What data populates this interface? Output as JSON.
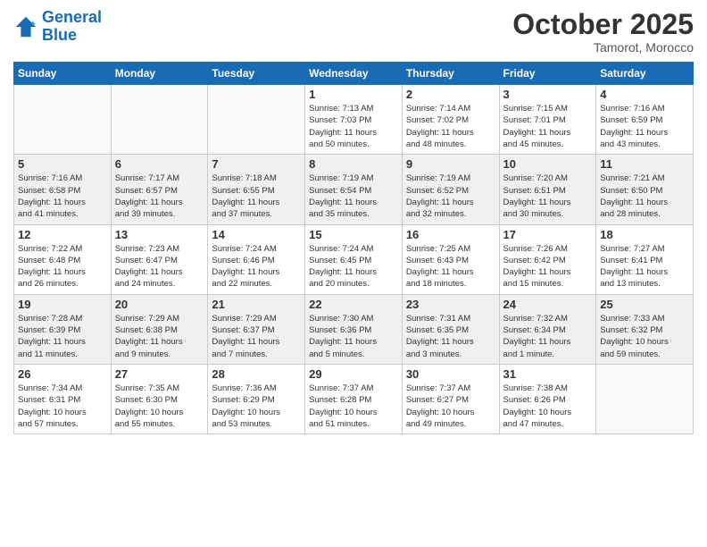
{
  "header": {
    "logo_line1": "General",
    "logo_line2": "Blue",
    "month": "October 2025",
    "location": "Tamorot, Morocco"
  },
  "weekdays": [
    "Sunday",
    "Monday",
    "Tuesday",
    "Wednesday",
    "Thursday",
    "Friday",
    "Saturday"
  ],
  "weeks": [
    [
      {
        "day": "",
        "info": ""
      },
      {
        "day": "",
        "info": ""
      },
      {
        "day": "",
        "info": ""
      },
      {
        "day": "1",
        "info": "Sunrise: 7:13 AM\nSunset: 7:03 PM\nDaylight: 11 hours\nand 50 minutes."
      },
      {
        "day": "2",
        "info": "Sunrise: 7:14 AM\nSunset: 7:02 PM\nDaylight: 11 hours\nand 48 minutes."
      },
      {
        "day": "3",
        "info": "Sunrise: 7:15 AM\nSunset: 7:01 PM\nDaylight: 11 hours\nand 45 minutes."
      },
      {
        "day": "4",
        "info": "Sunrise: 7:16 AM\nSunset: 6:59 PM\nDaylight: 11 hours\nand 43 minutes."
      }
    ],
    [
      {
        "day": "5",
        "info": "Sunrise: 7:16 AM\nSunset: 6:58 PM\nDaylight: 11 hours\nand 41 minutes."
      },
      {
        "day": "6",
        "info": "Sunrise: 7:17 AM\nSunset: 6:57 PM\nDaylight: 11 hours\nand 39 minutes."
      },
      {
        "day": "7",
        "info": "Sunrise: 7:18 AM\nSunset: 6:55 PM\nDaylight: 11 hours\nand 37 minutes."
      },
      {
        "day": "8",
        "info": "Sunrise: 7:19 AM\nSunset: 6:54 PM\nDaylight: 11 hours\nand 35 minutes."
      },
      {
        "day": "9",
        "info": "Sunrise: 7:19 AM\nSunset: 6:52 PM\nDaylight: 11 hours\nand 32 minutes."
      },
      {
        "day": "10",
        "info": "Sunrise: 7:20 AM\nSunset: 6:51 PM\nDaylight: 11 hours\nand 30 minutes."
      },
      {
        "day": "11",
        "info": "Sunrise: 7:21 AM\nSunset: 6:50 PM\nDaylight: 11 hours\nand 28 minutes."
      }
    ],
    [
      {
        "day": "12",
        "info": "Sunrise: 7:22 AM\nSunset: 6:48 PM\nDaylight: 11 hours\nand 26 minutes."
      },
      {
        "day": "13",
        "info": "Sunrise: 7:23 AM\nSunset: 6:47 PM\nDaylight: 11 hours\nand 24 minutes."
      },
      {
        "day": "14",
        "info": "Sunrise: 7:24 AM\nSunset: 6:46 PM\nDaylight: 11 hours\nand 22 minutes."
      },
      {
        "day": "15",
        "info": "Sunrise: 7:24 AM\nSunset: 6:45 PM\nDaylight: 11 hours\nand 20 minutes."
      },
      {
        "day": "16",
        "info": "Sunrise: 7:25 AM\nSunset: 6:43 PM\nDaylight: 11 hours\nand 18 minutes."
      },
      {
        "day": "17",
        "info": "Sunrise: 7:26 AM\nSunset: 6:42 PM\nDaylight: 11 hours\nand 15 minutes."
      },
      {
        "day": "18",
        "info": "Sunrise: 7:27 AM\nSunset: 6:41 PM\nDaylight: 11 hours\nand 13 minutes."
      }
    ],
    [
      {
        "day": "19",
        "info": "Sunrise: 7:28 AM\nSunset: 6:39 PM\nDaylight: 11 hours\nand 11 minutes."
      },
      {
        "day": "20",
        "info": "Sunrise: 7:29 AM\nSunset: 6:38 PM\nDaylight: 11 hours\nand 9 minutes."
      },
      {
        "day": "21",
        "info": "Sunrise: 7:29 AM\nSunset: 6:37 PM\nDaylight: 11 hours\nand 7 minutes."
      },
      {
        "day": "22",
        "info": "Sunrise: 7:30 AM\nSunset: 6:36 PM\nDaylight: 11 hours\nand 5 minutes."
      },
      {
        "day": "23",
        "info": "Sunrise: 7:31 AM\nSunset: 6:35 PM\nDaylight: 11 hours\nand 3 minutes."
      },
      {
        "day": "24",
        "info": "Sunrise: 7:32 AM\nSunset: 6:34 PM\nDaylight: 11 hours\nand 1 minute."
      },
      {
        "day": "25",
        "info": "Sunrise: 7:33 AM\nSunset: 6:32 PM\nDaylight: 10 hours\nand 59 minutes."
      }
    ],
    [
      {
        "day": "26",
        "info": "Sunrise: 7:34 AM\nSunset: 6:31 PM\nDaylight: 10 hours\nand 57 minutes."
      },
      {
        "day": "27",
        "info": "Sunrise: 7:35 AM\nSunset: 6:30 PM\nDaylight: 10 hours\nand 55 minutes."
      },
      {
        "day": "28",
        "info": "Sunrise: 7:36 AM\nSunset: 6:29 PM\nDaylight: 10 hours\nand 53 minutes."
      },
      {
        "day": "29",
        "info": "Sunrise: 7:37 AM\nSunset: 6:28 PM\nDaylight: 10 hours\nand 51 minutes."
      },
      {
        "day": "30",
        "info": "Sunrise: 7:37 AM\nSunset: 6:27 PM\nDaylight: 10 hours\nand 49 minutes."
      },
      {
        "day": "31",
        "info": "Sunrise: 7:38 AM\nSunset: 6:26 PM\nDaylight: 10 hours\nand 47 minutes."
      },
      {
        "day": "",
        "info": ""
      }
    ]
  ]
}
